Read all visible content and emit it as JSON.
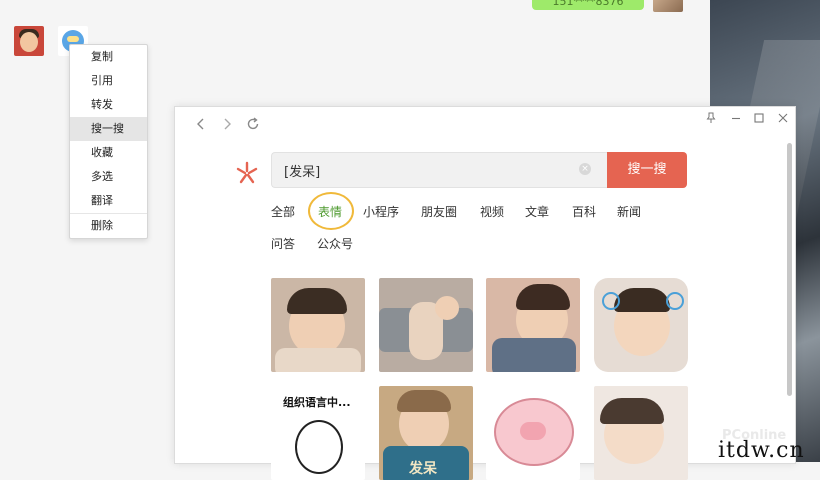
{
  "chat": {
    "sent_bubble_text": "151****8376",
    "context_menu": {
      "items": [
        "复制",
        "引用",
        "转发",
        "搜一搜",
        "收藏",
        "多选",
        "翻译"
      ],
      "delete_label": "删除",
      "active_index": 3
    }
  },
  "search_window": {
    "query": "[发呆]",
    "search_button_label": "搜一搜",
    "tabs_row1": [
      "全部",
      "表情",
      "小程序",
      "朋友圈",
      "视频",
      "文章",
      "百科",
      "新闻"
    ],
    "tabs_row2": [
      "问答",
      "公众号"
    ],
    "active_tab": "表情",
    "sticker_caption": "组织语言中...",
    "sticker_partial_caption": "发呆",
    "colors": {
      "accent_search": "#e56451",
      "active_tab": "#4e9a2f",
      "highlight_circle": "#f0b93a"
    }
  },
  "watermark": {
    "site": "PConline",
    "domain_text": "itdw.cn"
  }
}
